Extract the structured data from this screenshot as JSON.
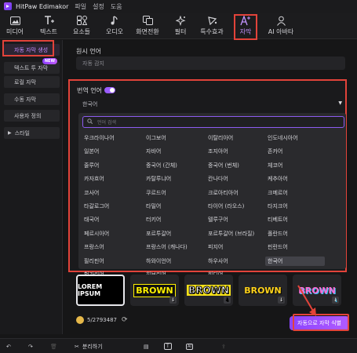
{
  "app": {
    "title": "HitPaw Edimakor",
    "menus": [
      "파일",
      "설정",
      "도움"
    ]
  },
  "toolbar": {
    "items": [
      {
        "label": "미디어",
        "icon": "media-icon"
      },
      {
        "label": "텍스트",
        "icon": "text-icon"
      },
      {
        "label": "요소들",
        "icon": "elements-icon"
      },
      {
        "label": "오디오",
        "icon": "audio-icon"
      },
      {
        "label": "화면전환",
        "icon": "transition-icon"
      },
      {
        "label": "필터",
        "icon": "filter-icon"
      },
      {
        "label": "특수효과",
        "icon": "effects-icon"
      },
      {
        "label": "자막",
        "icon": "subtitle-icon"
      },
      {
        "label": "AI 아바타",
        "icon": "ai-avatar-icon"
      }
    ],
    "active": "자막"
  },
  "sidebar": {
    "items": [
      {
        "label": "자동 자막 생성"
      },
      {
        "label": "텍스트 투 자막",
        "badge": "NEW"
      },
      {
        "label": "로컬 자막"
      },
      {
        "label": "수동 자막"
      },
      {
        "label": "사용자 정의"
      },
      {
        "label": "스타일"
      }
    ]
  },
  "source": {
    "label": "원시 언어",
    "value": "자동 감지"
  },
  "translate": {
    "label": "번역 언어",
    "enabled": true,
    "value": "한국어",
    "search_placeholder": "언어 검색",
    "languages": [
      "우크라이나어",
      "이그보어",
      "이탈리아어",
      "인도네시아어",
      "일본어",
      "자바어",
      "조지아어",
      "존카어",
      "줄루어",
      "중국어 (간체)",
      "중국어 (번체)",
      "체코어",
      "카자흐어",
      "카탈루냐어",
      "칸나다어",
      "케추아어",
      "코사어",
      "쿠르드어",
      "크로아티아어",
      "크메르어",
      "타갈로그어",
      "타밀어",
      "타이어 (라오스)",
      "타지크어",
      "태국어",
      "터키어",
      "텔루구어",
      "티베트어",
      "페르시아어",
      "포르투갈어",
      "포르투갈어 (브라질)",
      "폴란드어",
      "프랑스어",
      "프랑스어 (캐나다)",
      "피지어",
      "핀란드어",
      "필리핀어",
      "하와이언어",
      "하우사어",
      "한국어",
      "헝가리어",
      "히브리어",
      "힌디어"
    ],
    "selected": "한국어"
  },
  "styles": {
    "cards": [
      {
        "text": "LOREM IPSUM"
      },
      {
        "text": "BROWN"
      },
      {
        "text": "BROWN"
      },
      {
        "text": "BROWN"
      },
      {
        "text": "BROWN"
      }
    ]
  },
  "credits": {
    "value": "5/2793487"
  },
  "auto_button": {
    "label": "자동으로 자막 식별"
  },
  "bottombar": {
    "split_label": "분리하기"
  },
  "colors": {
    "accent": "#9b5cff",
    "highlight": "#e2433a",
    "bg": "#161617"
  }
}
